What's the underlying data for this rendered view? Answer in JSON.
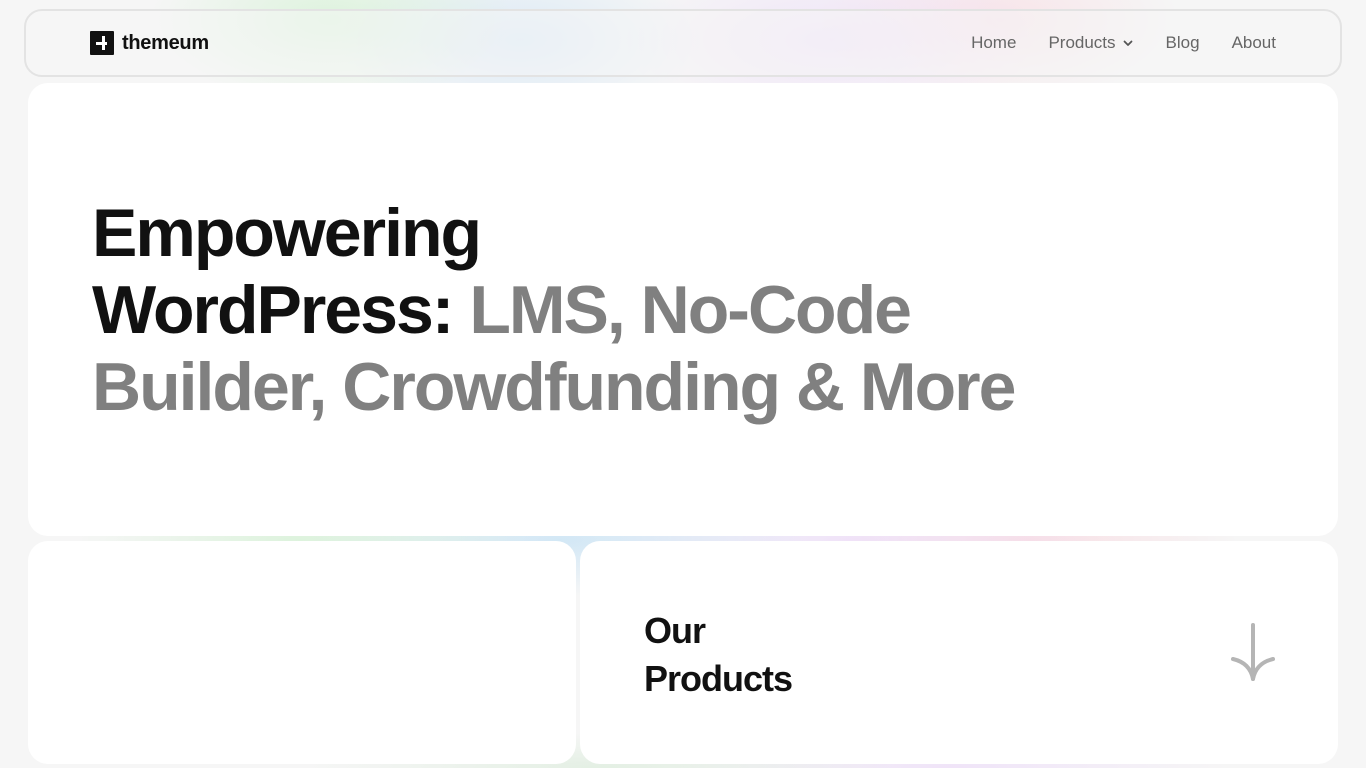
{
  "brand": {
    "name": "themeum",
    "logo_icon": "themeum-logo-icon"
  },
  "nav": {
    "items": [
      {
        "label": "Home"
      },
      {
        "label": "Products",
        "icon": "chevron-down-icon"
      },
      {
        "label": "Blog"
      },
      {
        "label": "About"
      }
    ]
  },
  "hero": {
    "title_line1": "Empowering",
    "title_strong": "WordPress:",
    "title_muted": "LMS, No-Code Builder, Crowdfunding & More"
  },
  "products": {
    "title_line1": "Our",
    "title_line2": "Products",
    "icon": "arrow-down-icon"
  },
  "colors": {
    "text_primary": "#111111",
    "text_muted": "#808080",
    "nav_text": "#666666",
    "background": "#f6f6f6",
    "card": "#ffffff"
  }
}
